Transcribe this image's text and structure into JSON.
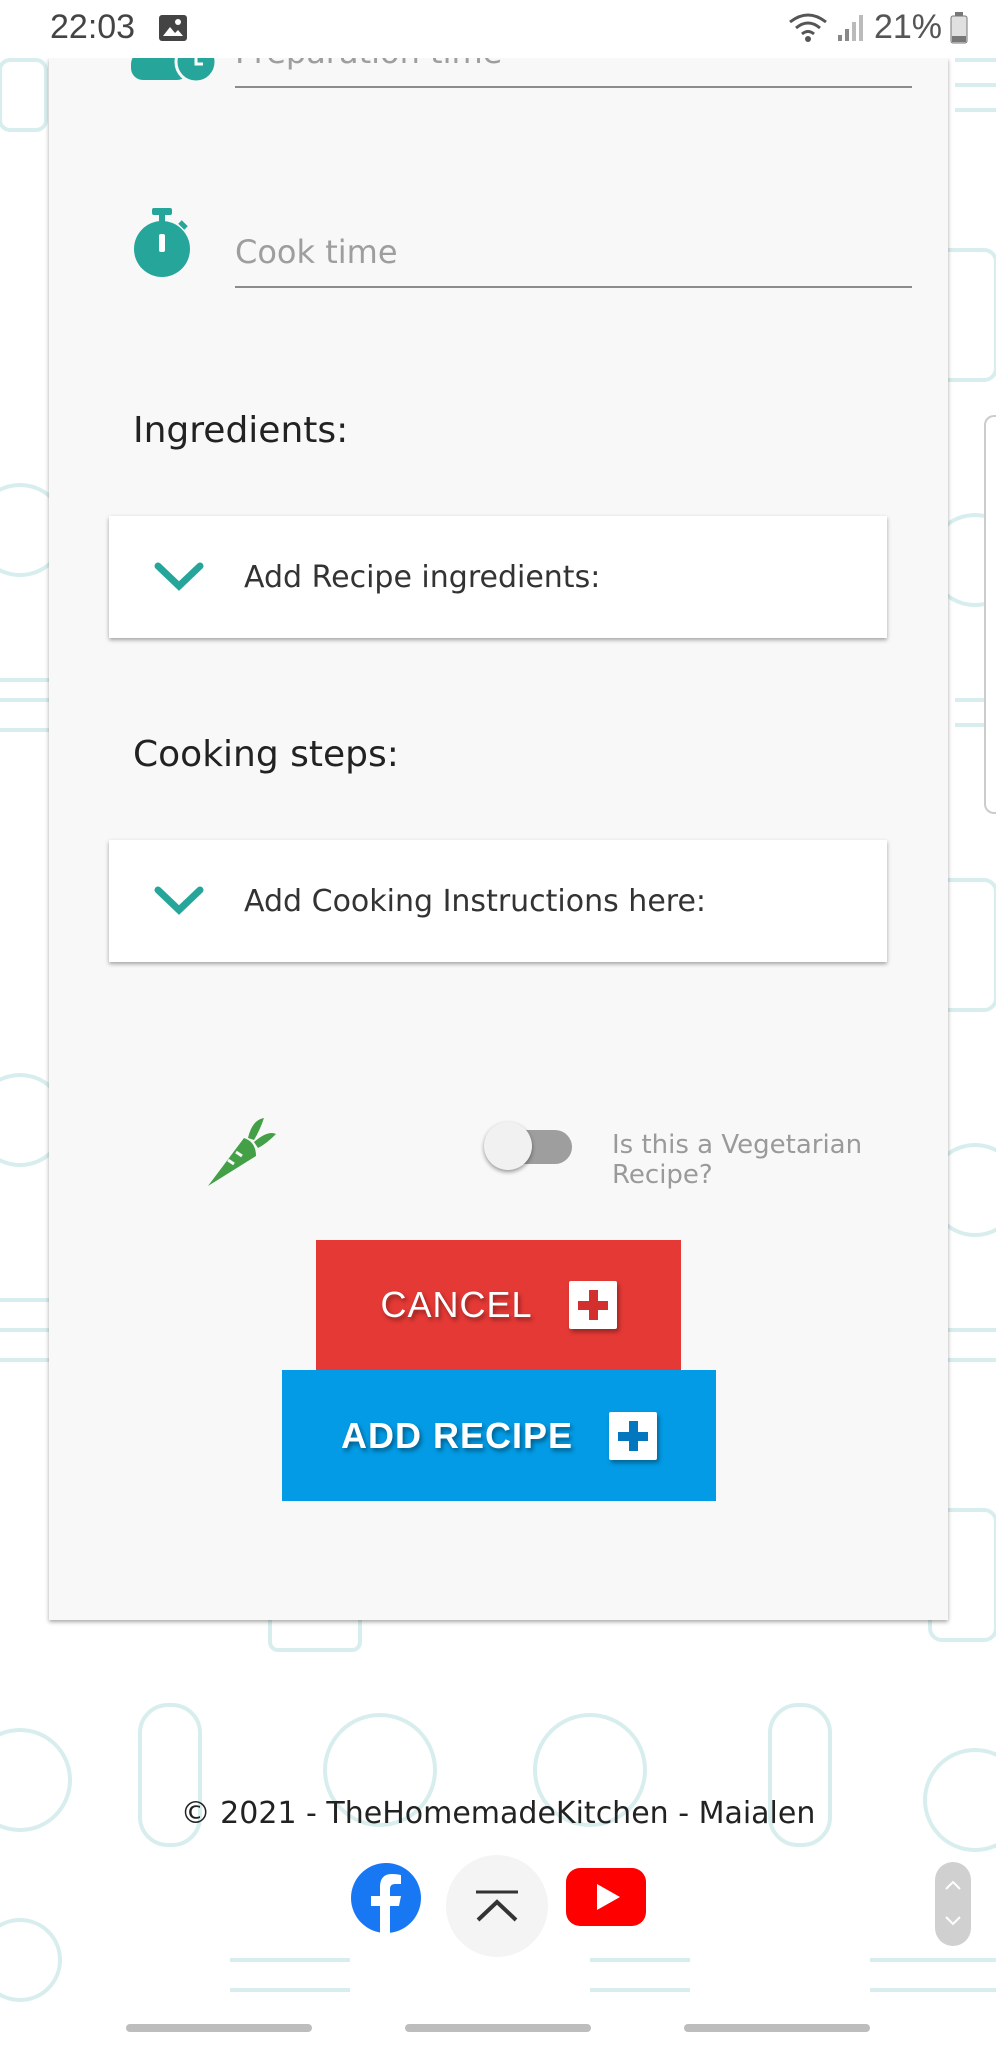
{
  "status_bar": {
    "time": "22:03",
    "battery": "21%",
    "icons": [
      "gallery-icon",
      "wifi-icon",
      "signal-icon",
      "battery-icon"
    ]
  },
  "form": {
    "prep_time_placeholder": "Preparation time",
    "cook_time_placeholder": "Cook time",
    "ingredients_label": "Ingredients:",
    "ingredients_toggle": "Add Recipe ingredients:",
    "steps_label": "Cooking steps:",
    "steps_toggle": "Add Cooking Instructions here:",
    "vegetarian_label": "Is this a Vegetarian Recipe?",
    "vegetarian_checked": false,
    "cancel_label": "CANCEL",
    "add_label": "ADD RECIPE"
  },
  "footer": {
    "copyright": "© 2021 - TheHomemadeKitchen - Maialen",
    "social": [
      "facebook-icon",
      "youtube-icon"
    ]
  },
  "colors": {
    "teal": "#26a69a",
    "cancel": "#e53935",
    "add": "#039be5",
    "carrot": "#43a047",
    "facebook": "#1877f2",
    "youtube": "#ff0000"
  }
}
